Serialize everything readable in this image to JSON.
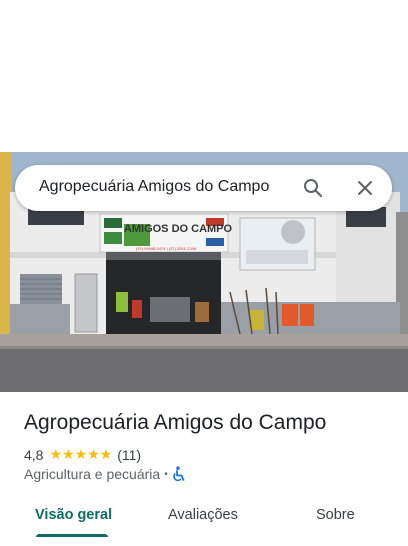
{
  "search": {
    "query": "Agropecuária Amigos do Campo"
  },
  "photo": {
    "sign_main": "AMIGOS DO CAMPO",
    "sign_small_top": "Agropecuária",
    "sign_phones": "(37) 99948-0474 | (37) 3261-2346"
  },
  "place": {
    "name": "Agropecuária Amigos do Campo",
    "rating": "4,8",
    "stars": "★★★★★",
    "review_count": "(11)",
    "category": "Agricultura e pecuária",
    "separator": "•"
  },
  "tabs": [
    {
      "label": "Visão geral",
      "active": true
    },
    {
      "label": "Avaliações",
      "active": false
    },
    {
      "label": "Sobre",
      "active": false
    }
  ],
  "colors": {
    "accent": "#0f6b64",
    "star": "#fbbc04",
    "wheelchair": "#1a73e8"
  }
}
